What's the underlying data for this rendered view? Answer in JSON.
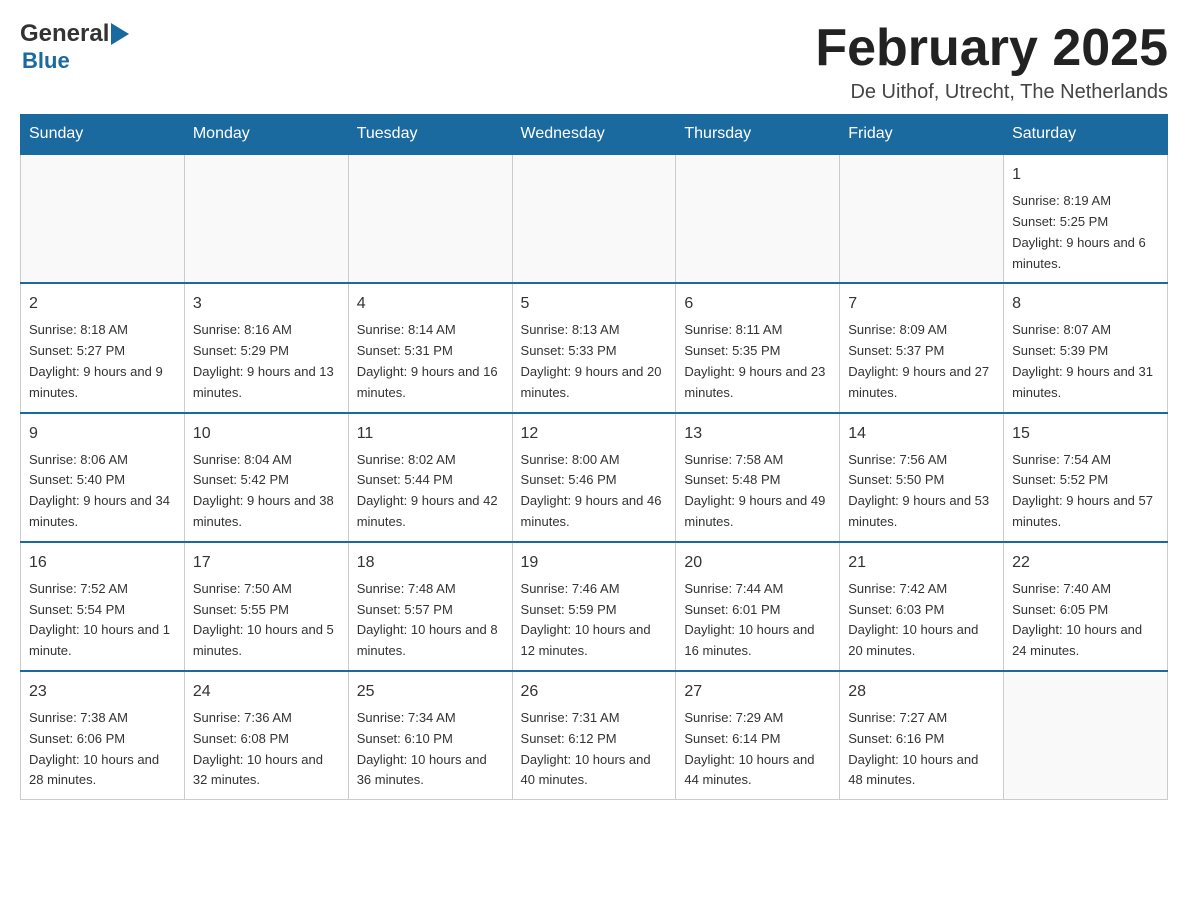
{
  "header": {
    "logo_general": "General",
    "logo_blue": "Blue",
    "month_title": "February 2025",
    "location": "De Uithof, Utrecht, The Netherlands"
  },
  "weekdays": [
    "Sunday",
    "Monday",
    "Tuesday",
    "Wednesday",
    "Thursday",
    "Friday",
    "Saturday"
  ],
  "weeks": [
    [
      {
        "day": "",
        "info": ""
      },
      {
        "day": "",
        "info": ""
      },
      {
        "day": "",
        "info": ""
      },
      {
        "day": "",
        "info": ""
      },
      {
        "day": "",
        "info": ""
      },
      {
        "day": "",
        "info": ""
      },
      {
        "day": "1",
        "info": "Sunrise: 8:19 AM\nSunset: 5:25 PM\nDaylight: 9 hours and 6 minutes."
      }
    ],
    [
      {
        "day": "2",
        "info": "Sunrise: 8:18 AM\nSunset: 5:27 PM\nDaylight: 9 hours and 9 minutes."
      },
      {
        "day": "3",
        "info": "Sunrise: 8:16 AM\nSunset: 5:29 PM\nDaylight: 9 hours and 13 minutes."
      },
      {
        "day": "4",
        "info": "Sunrise: 8:14 AM\nSunset: 5:31 PM\nDaylight: 9 hours and 16 minutes."
      },
      {
        "day": "5",
        "info": "Sunrise: 8:13 AM\nSunset: 5:33 PM\nDaylight: 9 hours and 20 minutes."
      },
      {
        "day": "6",
        "info": "Sunrise: 8:11 AM\nSunset: 5:35 PM\nDaylight: 9 hours and 23 minutes."
      },
      {
        "day": "7",
        "info": "Sunrise: 8:09 AM\nSunset: 5:37 PM\nDaylight: 9 hours and 27 minutes."
      },
      {
        "day": "8",
        "info": "Sunrise: 8:07 AM\nSunset: 5:39 PM\nDaylight: 9 hours and 31 minutes."
      }
    ],
    [
      {
        "day": "9",
        "info": "Sunrise: 8:06 AM\nSunset: 5:40 PM\nDaylight: 9 hours and 34 minutes."
      },
      {
        "day": "10",
        "info": "Sunrise: 8:04 AM\nSunset: 5:42 PM\nDaylight: 9 hours and 38 minutes."
      },
      {
        "day": "11",
        "info": "Sunrise: 8:02 AM\nSunset: 5:44 PM\nDaylight: 9 hours and 42 minutes."
      },
      {
        "day": "12",
        "info": "Sunrise: 8:00 AM\nSunset: 5:46 PM\nDaylight: 9 hours and 46 minutes."
      },
      {
        "day": "13",
        "info": "Sunrise: 7:58 AM\nSunset: 5:48 PM\nDaylight: 9 hours and 49 minutes."
      },
      {
        "day": "14",
        "info": "Sunrise: 7:56 AM\nSunset: 5:50 PM\nDaylight: 9 hours and 53 minutes."
      },
      {
        "day": "15",
        "info": "Sunrise: 7:54 AM\nSunset: 5:52 PM\nDaylight: 9 hours and 57 minutes."
      }
    ],
    [
      {
        "day": "16",
        "info": "Sunrise: 7:52 AM\nSunset: 5:54 PM\nDaylight: 10 hours and 1 minute."
      },
      {
        "day": "17",
        "info": "Sunrise: 7:50 AM\nSunset: 5:55 PM\nDaylight: 10 hours and 5 minutes."
      },
      {
        "day": "18",
        "info": "Sunrise: 7:48 AM\nSunset: 5:57 PM\nDaylight: 10 hours and 8 minutes."
      },
      {
        "day": "19",
        "info": "Sunrise: 7:46 AM\nSunset: 5:59 PM\nDaylight: 10 hours and 12 minutes."
      },
      {
        "day": "20",
        "info": "Sunrise: 7:44 AM\nSunset: 6:01 PM\nDaylight: 10 hours and 16 minutes."
      },
      {
        "day": "21",
        "info": "Sunrise: 7:42 AM\nSunset: 6:03 PM\nDaylight: 10 hours and 20 minutes."
      },
      {
        "day": "22",
        "info": "Sunrise: 7:40 AM\nSunset: 6:05 PM\nDaylight: 10 hours and 24 minutes."
      }
    ],
    [
      {
        "day": "23",
        "info": "Sunrise: 7:38 AM\nSunset: 6:06 PM\nDaylight: 10 hours and 28 minutes."
      },
      {
        "day": "24",
        "info": "Sunrise: 7:36 AM\nSunset: 6:08 PM\nDaylight: 10 hours and 32 minutes."
      },
      {
        "day": "25",
        "info": "Sunrise: 7:34 AM\nSunset: 6:10 PM\nDaylight: 10 hours and 36 minutes."
      },
      {
        "day": "26",
        "info": "Sunrise: 7:31 AM\nSunset: 6:12 PM\nDaylight: 10 hours and 40 minutes."
      },
      {
        "day": "27",
        "info": "Sunrise: 7:29 AM\nSunset: 6:14 PM\nDaylight: 10 hours and 44 minutes."
      },
      {
        "day": "28",
        "info": "Sunrise: 7:27 AM\nSunset: 6:16 PM\nDaylight: 10 hours and 48 minutes."
      },
      {
        "day": "",
        "info": ""
      }
    ]
  ]
}
